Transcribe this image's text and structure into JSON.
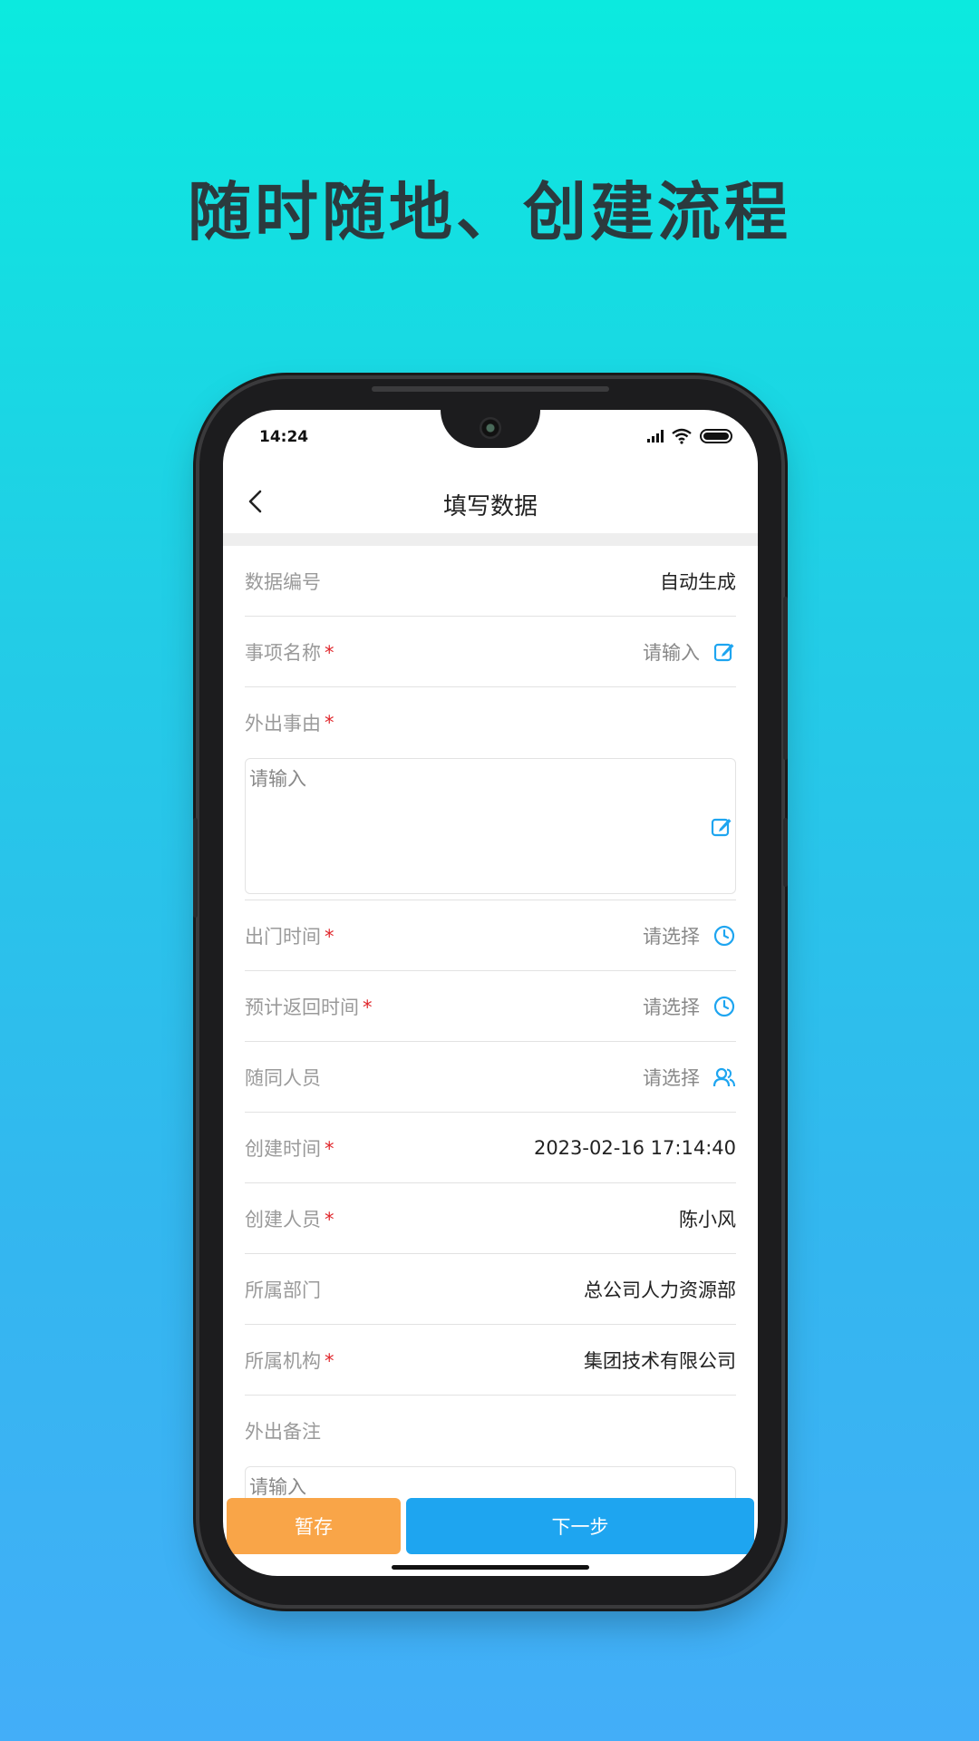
{
  "headline": "随时随地、创建流程",
  "status": {
    "time": "14:24"
  },
  "nav": {
    "title": "填写数据"
  },
  "fields": [
    {
      "label": "数据编号",
      "value": "自动生成"
    },
    {
      "label": "事项名称",
      "placeholder": "请输入"
    },
    {
      "label": "外出事由",
      "placeholder": "请输入"
    },
    {
      "label": "出门时间",
      "placeholder": "请选择"
    },
    {
      "label": "预计返回时间",
      "placeholder": "请选择"
    },
    {
      "label": "随同人员",
      "placeholder": "请选择"
    },
    {
      "label": "创建时间",
      "value": "2023-02-16 17:14:40"
    },
    {
      "label": "创建人员",
      "value": "陈小风"
    },
    {
      "label": "所属部门",
      "value": "总公司人力资源部"
    },
    {
      "label": "所属机构",
      "value": "集团技术有限公司"
    },
    {
      "label": "外出备注",
      "placeholder": "请输入"
    }
  ],
  "required_mark": "*",
  "buttons": {
    "save": "暂存",
    "next": "下一步"
  },
  "colors": {
    "accent": "#1ea5f0",
    "save": "#f9a548",
    "required": "#e0262b"
  }
}
